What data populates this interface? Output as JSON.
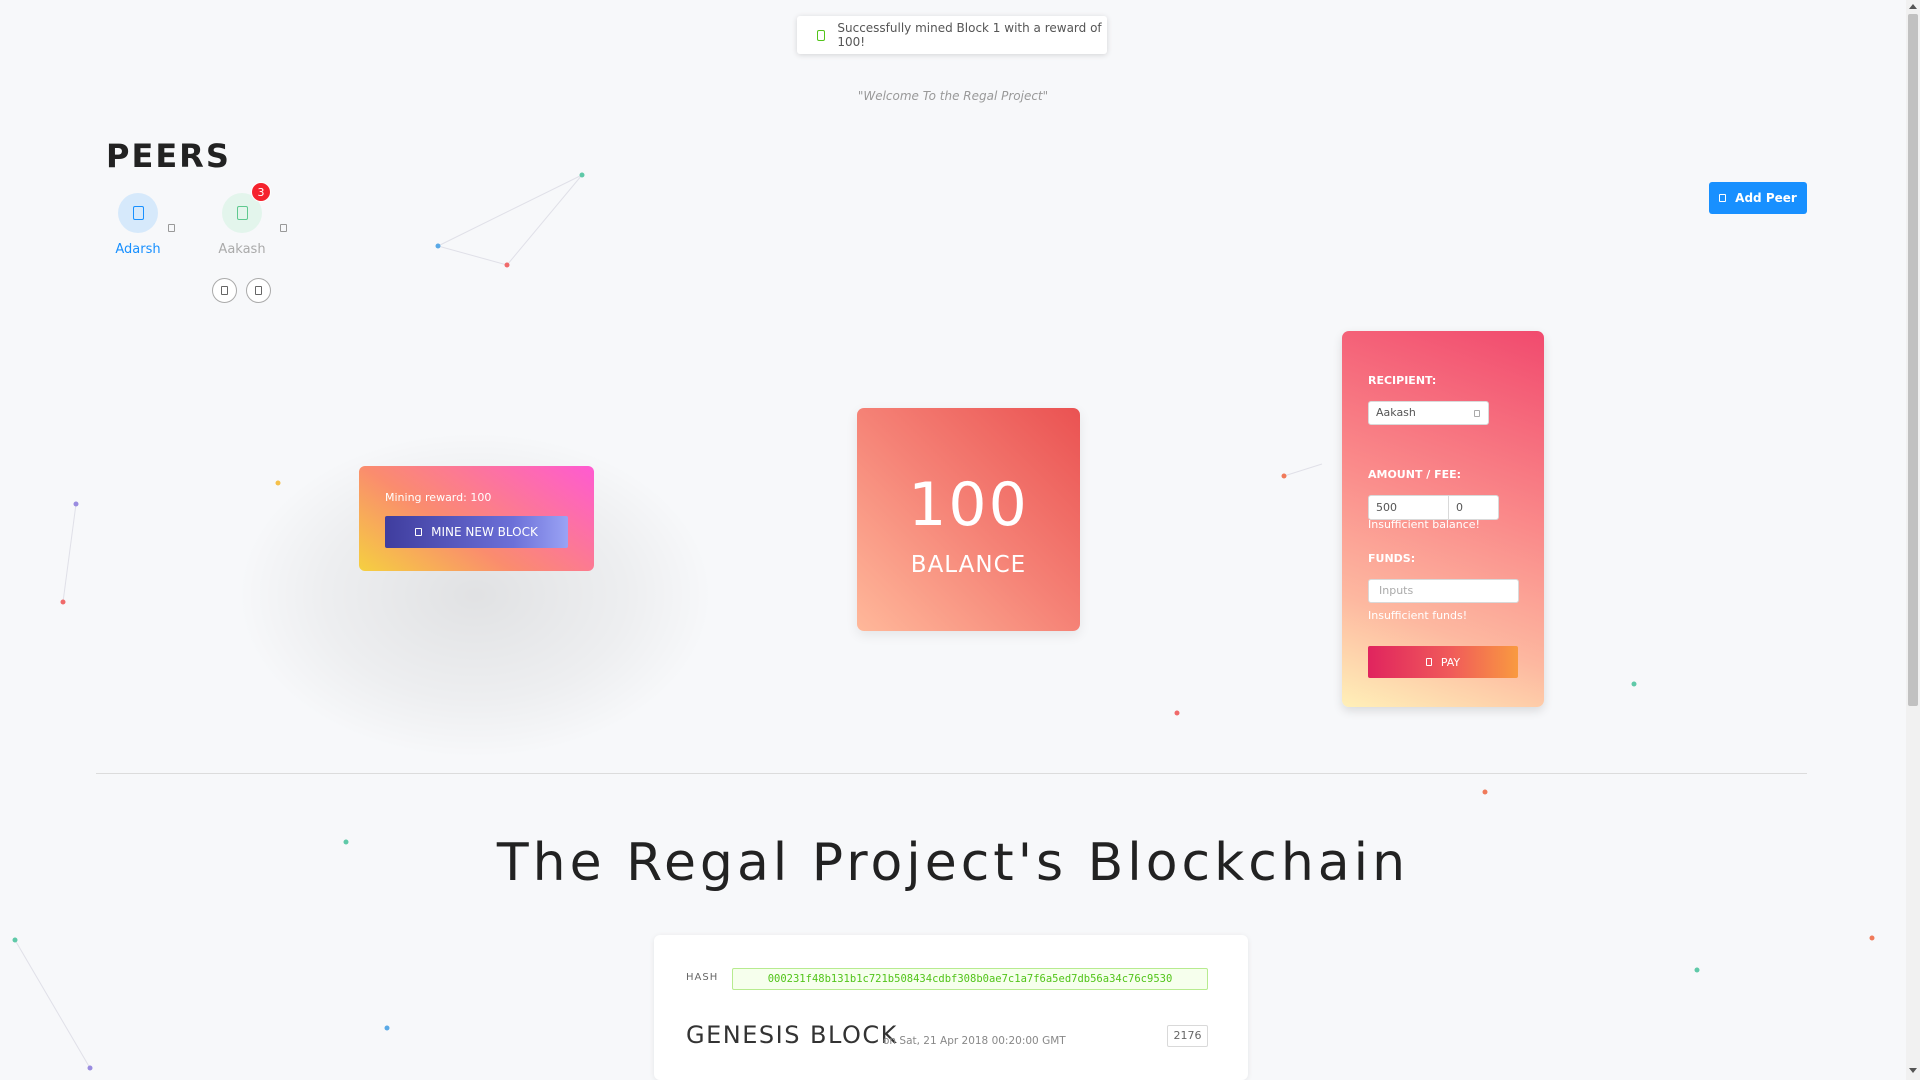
{
  "notification": {
    "text": "Successfully mined Block 1 with a reward of 100!"
  },
  "tagline": "\"Welcome To the Regal Project\"",
  "peers": {
    "title": "PEERS",
    "items": [
      {
        "name": "Adarsh",
        "color": "#1890ff"
      },
      {
        "name": "Aakash",
        "color": "#aaaaaa",
        "badge": "3"
      }
    ],
    "add_button": "Add Peer"
  },
  "mining": {
    "reward_text": "Mining reward: 100",
    "button_label": "MINE NEW BLOCK"
  },
  "balance": {
    "amount": "100",
    "label": "BALANCE"
  },
  "payment": {
    "recipient_label": "RECIPIENT:",
    "recipient_value": "Aakash",
    "amount_fee_label": "AMOUNT / FEE:",
    "amount_value": "500",
    "fee_value": "0",
    "balance_error": "Insufficient balance!",
    "funds_label": "FUNDS:",
    "funds_placeholder": "Inputs",
    "funds_error": "Insufficient funds!",
    "pay_button": "PAY"
  },
  "blockchain": {
    "title": "The Regal Project's Blockchain",
    "blocks": [
      {
        "hash_label": "HASH",
        "hash": "000231f48b131b1c721b508434cdbf308b0ae7c1a7f6a5ed7db56a34c76c9530",
        "name": "GENESIS BLOCK",
        "date": "on Sat, 21 Apr 2018 00:20:00 GMT",
        "nonce": "2176"
      }
    ]
  },
  "colors": {
    "primary": "#1890ff",
    "success": "#52c41a",
    "danger": "#f5222d"
  }
}
